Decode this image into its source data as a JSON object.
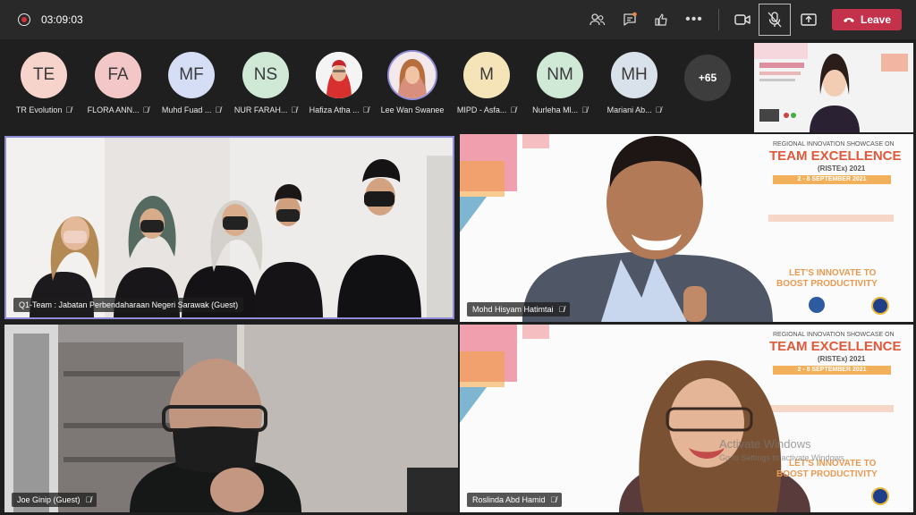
{
  "meeting": {
    "timer": "03:09:03",
    "leave_label": "Leave"
  },
  "toolbar_icons": [
    "people-icon",
    "chat-icon",
    "reactions-icon",
    "more-icon",
    "camera-icon",
    "mic-off-icon",
    "share-icon"
  ],
  "participants": [
    {
      "initials": "TE",
      "name": "TR Evolution",
      "color": "#f6d3cb"
    },
    {
      "initials": "FA",
      "name": "FLORA ANN...",
      "color": "#f3c7c7"
    },
    {
      "initials": "MF",
      "name": "Muhd Fuad ...",
      "color": "#d5def5"
    },
    {
      "initials": "NS",
      "name": "NUR FARAH...",
      "color": "#cfe9d6"
    },
    {
      "initials": "",
      "name": "Hafiza Atha ...",
      "color": "#ffffff"
    },
    {
      "initials": "",
      "name": "Lee Wan Swanee",
      "color": "#ffffff"
    },
    {
      "initials": "M",
      "name": "MIPD - Asfa...",
      "color": "#f4e4b8"
    },
    {
      "initials": "NM",
      "name": "Nurleha Ml...",
      "color": "#cfe9d6"
    },
    {
      "initials": "MH",
      "name": "Mariani Ab...",
      "color": "#d9e2ea"
    }
  ],
  "overflow_count": "+65",
  "tiles": [
    {
      "label": "Q1-Team : Jabatan Perbendaharaan Negeri Sarawak (Guest)"
    },
    {
      "label": "Mohd Hisyam Hatimtai"
    },
    {
      "label": "Joe Ginip (Guest)"
    },
    {
      "label": "Roslinda Abd Hamid"
    }
  ],
  "banner": {
    "line1": "REGIONAL INNOVATION SHOWCASE ON",
    "title": "TEAM EXCELLENCE",
    "sub": "(RISTEx) 2021",
    "dates": "2 - 8 SEPTEMBER 2021",
    "tagline1": "LET'S INNOVATE TO",
    "tagline2": "BOOST PRODUCTIVITY"
  },
  "os_watermark": {
    "title": "Activate Windows",
    "subtitle": "Go to Settings to activate Windows."
  }
}
